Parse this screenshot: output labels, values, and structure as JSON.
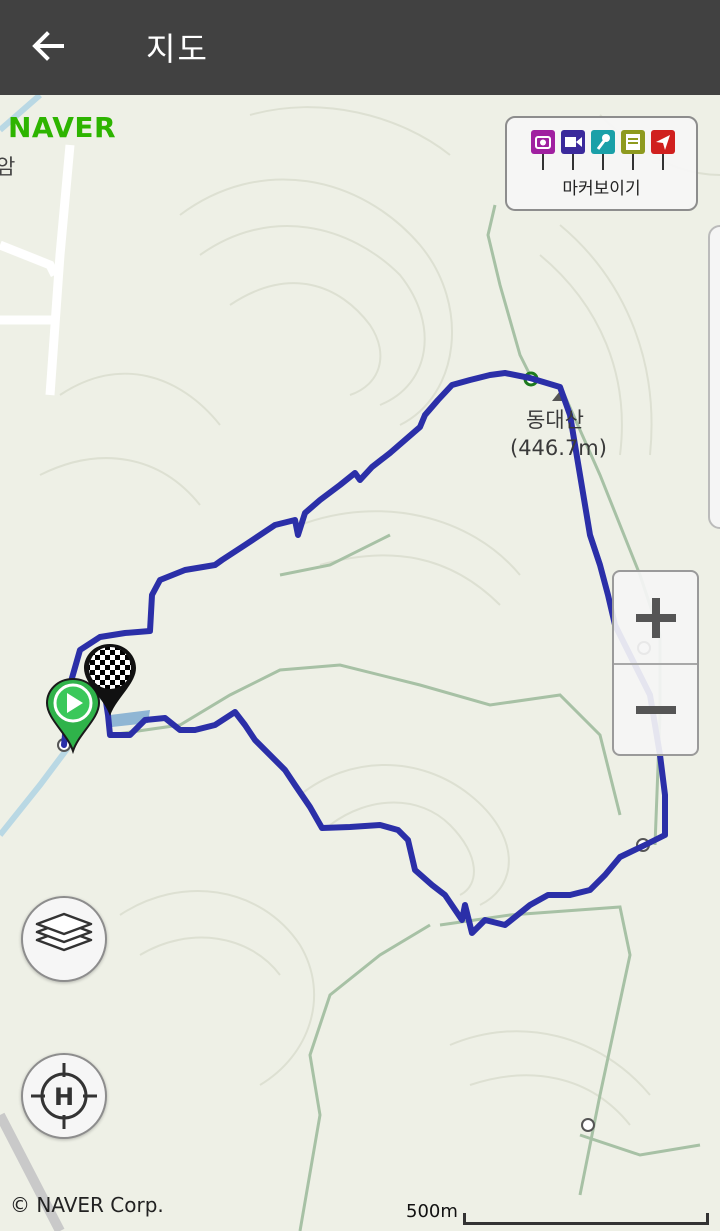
{
  "header": {
    "title": "지도",
    "back_icon": "back-arrow-icon"
  },
  "map": {
    "provider_logo": "NAVER",
    "edge_label": "암",
    "peak": {
      "name": "동대산",
      "elevation": "(446.7m)"
    },
    "copyright": "© NAVER Corp.",
    "scale_label": "500m",
    "route_color": "#2b2fa8",
    "marker_panel": {
      "label": "마커보이기",
      "pins": [
        {
          "icon": "camera-icon",
          "color": "#a020a0"
        },
        {
          "icon": "video-icon",
          "color": "#3b2a9c"
        },
        {
          "icon": "microphone-icon",
          "color": "#1aa0a8"
        },
        {
          "icon": "memo-icon",
          "color": "#8e9a1e"
        },
        {
          "icon": "location-arrow-icon",
          "color": "#d0201e"
        }
      ]
    },
    "zoom": {
      "in_icon": "plus-icon",
      "out_icon": "minus-icon"
    },
    "controls": {
      "layers_icon": "layers-icon",
      "home_icon": "home-target-icon"
    },
    "start_marker": "start-play-icon",
    "finish_marker": "finish-checkered-icon"
  }
}
